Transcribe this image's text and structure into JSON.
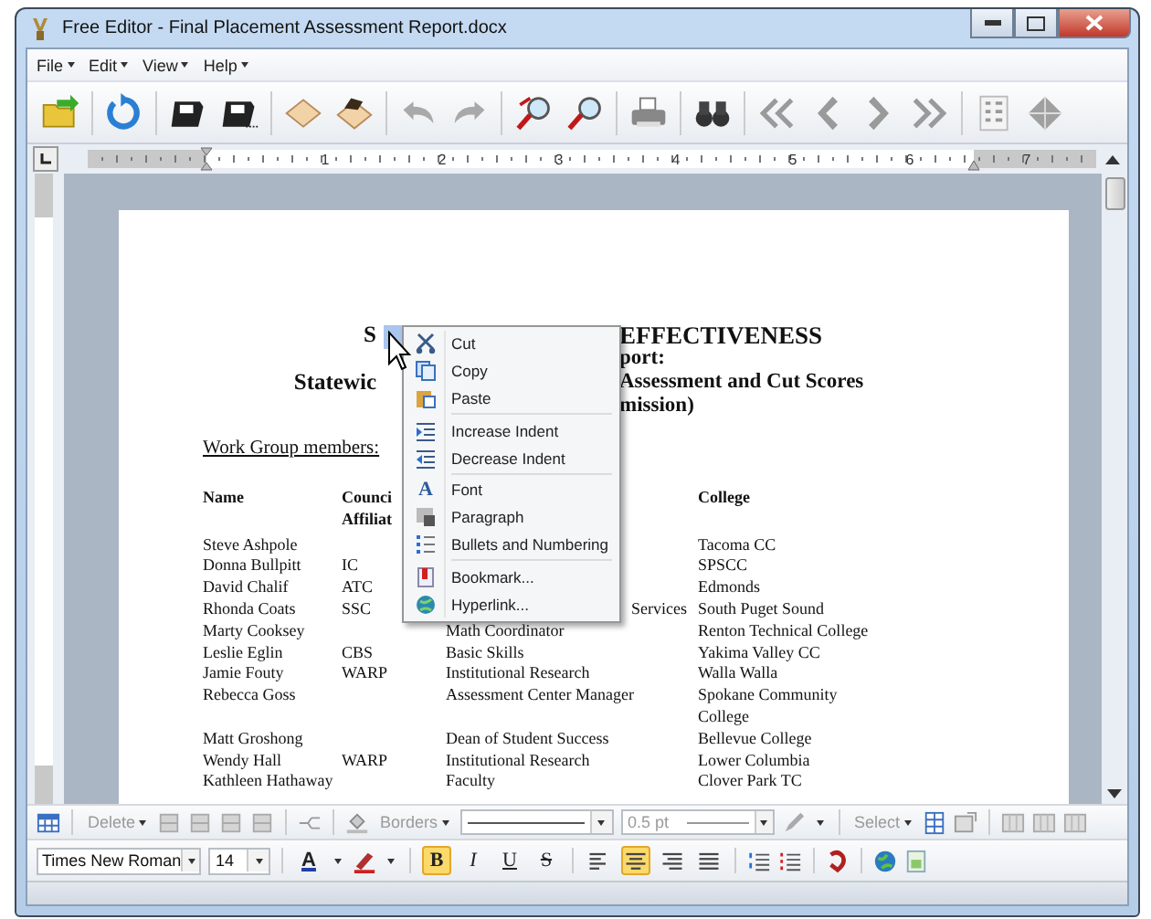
{
  "window": {
    "title": "Free Editor - Final Placement Assessment Report.docx"
  },
  "menu": [
    {
      "label": "File"
    },
    {
      "label": "Edit"
    },
    {
      "label": "View"
    },
    {
      "label": "Help"
    }
  ],
  "ruler": {
    "numbers": [
      "1",
      "2",
      "3",
      "4",
      "5",
      "6",
      "7"
    ]
  },
  "document": {
    "heading_lines": [
      {
        "left": "S",
        "right": "EFFECTIVENESS"
      },
      {
        "right": "port:"
      },
      {
        "left": "Statewic",
        "right": "Assessment and Cut Scores"
      },
      {
        "right": "mission)"
      }
    ],
    "work_group_label": "Work Group members:",
    "table": {
      "header": {
        "column_1": "Name",
        "column_2": "Counci\nAffiliat",
        "column_4": "College"
      },
      "rows": [
        {
          "column_1": "Steve Ashpole",
          "column_4": "Tacoma CC"
        },
        {
          "column_1": "Donna Bullpitt",
          "column_2": "IC",
          "column_4": "SPSCC"
        },
        {
          "column_1": "David Chalif",
          "column_2": "ATC",
          "column_4": "Edmonds"
        },
        {
          "column_1": "Rhonda Coats",
          "column_2": "SSC",
          "column_3": "Services",
          "column_3_cut_left": true,
          "column_4": "South Puget Sound"
        },
        {
          "column_1": "Marty Cooksey",
          "column_3": "Math Coordinator",
          "column_4": "Renton Technical College"
        },
        {
          "column_1": "Leslie Eglin",
          "column_2": "CBS",
          "column_3": "Basic Skills",
          "column_4": "Yakima Valley CC"
        },
        {
          "column_1": "Jamie Fouty",
          "column_2": "WARP",
          "column_3": "Institutional Research",
          "column_4": "Walla Walla"
        },
        {
          "column_1": "Rebecca Goss",
          "column_3": "Assessment Center Manager",
          "column_4": "Spokane Community\nCollege"
        },
        {
          "column_1": "Matt Groshong",
          "column_3": "Dean of Student Success",
          "column_4": "Bellevue College"
        },
        {
          "column_1": "Wendy Hall",
          "column_2": "WARP",
          "column_3": "Institutional Research",
          "column_4": "Lower Columbia"
        },
        {
          "column_1": "Kathleen Hathaway",
          "column_3": "Faculty",
          "column_4": "Clover Park TC"
        }
      ]
    }
  },
  "context_menu": [
    {
      "kind": "cut",
      "label": "Cut"
    },
    {
      "kind": "copy",
      "label": "Copy"
    },
    {
      "kind": "paste",
      "label": "Paste"
    },
    {
      "kind": "separator"
    },
    {
      "kind": "indent-increase",
      "label": "Increase Indent"
    },
    {
      "kind": "indent-decrease",
      "label": "Decrease Indent"
    },
    {
      "kind": "separator"
    },
    {
      "kind": "font",
      "label": "Font",
      "icon_letter": "A"
    },
    {
      "kind": "paragraph",
      "label": "Paragraph"
    },
    {
      "kind": "bullets",
      "label": "Bullets and Numbering"
    },
    {
      "kind": "separator"
    },
    {
      "kind": "bookmark",
      "label": "Bookmark..."
    },
    {
      "kind": "hyperlink",
      "label": "Hyperlink..."
    }
  ],
  "table_toolbar": {
    "delete": {
      "label": "Delete",
      "disabled": true
    },
    "borders": {
      "label": "Borders",
      "disabled": true
    },
    "line_width": {
      "value": "0.5 pt",
      "disabled": true
    },
    "select": {
      "label": "Select",
      "disabled": true
    }
  },
  "format_toolbar": {
    "font": "Times New Roman",
    "size": "14",
    "color_letter": "A",
    "styles": [
      {
        "label": "B",
        "selected": true
      },
      {
        "label": "I",
        "selected": false
      },
      {
        "label": "U",
        "selected": false
      },
      {
        "label": "S",
        "selected": false
      }
    ],
    "alignment": [
      {
        "kind": "left",
        "selected": false
      },
      {
        "kind": "center",
        "selected": true
      },
      {
        "kind": "right",
        "selected": false
      },
      {
        "kind": "justify",
        "selected": false
      }
    ]
  }
}
